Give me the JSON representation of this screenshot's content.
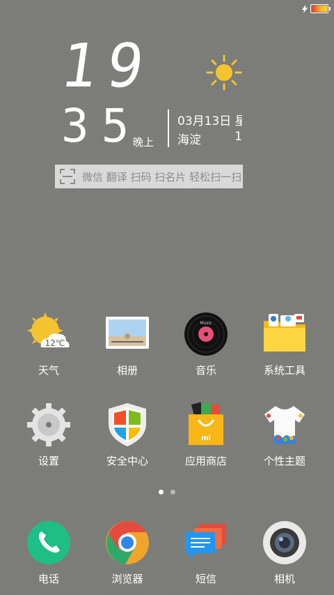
{
  "clock": {
    "hour": "19",
    "minute": "35",
    "ampm": "晚上"
  },
  "weather_widget": {
    "date": "03月13日 星",
    "location": "海淀",
    "temp_partial": "1"
  },
  "scan_bar": {
    "text": "微信 翻译 扫码 扫名片 轻松扫一扫"
  },
  "apps": [
    {
      "label": "天气",
      "icon": "weather-icon",
      "temp": "12℃"
    },
    {
      "label": "相册",
      "icon": "gallery-icon"
    },
    {
      "label": "音乐",
      "icon": "music-icon",
      "disc_text": "Music"
    },
    {
      "label": "系统工具",
      "icon": "folder-icon"
    },
    {
      "label": "设置",
      "icon": "gear-icon"
    },
    {
      "label": "安全中心",
      "icon": "shield-icon"
    },
    {
      "label": "应用商店",
      "icon": "store-bag-icon",
      "bag_text": "mi"
    },
    {
      "label": "个性主题",
      "icon": "theme-shirt-icon"
    }
  ],
  "dock": [
    {
      "label": "电话",
      "icon": "phone-icon"
    },
    {
      "label": "浏览器",
      "icon": "browser-icon"
    },
    {
      "label": "短信",
      "icon": "message-icon"
    },
    {
      "label": "相机",
      "icon": "camera-icon"
    }
  ],
  "page_indicator": {
    "pages": 2,
    "current": 1
  },
  "colors": {
    "background": "#7b7b78",
    "sun": "#f4c430",
    "phone": "#1dbf87",
    "scanbar": "#d9d9d9"
  }
}
